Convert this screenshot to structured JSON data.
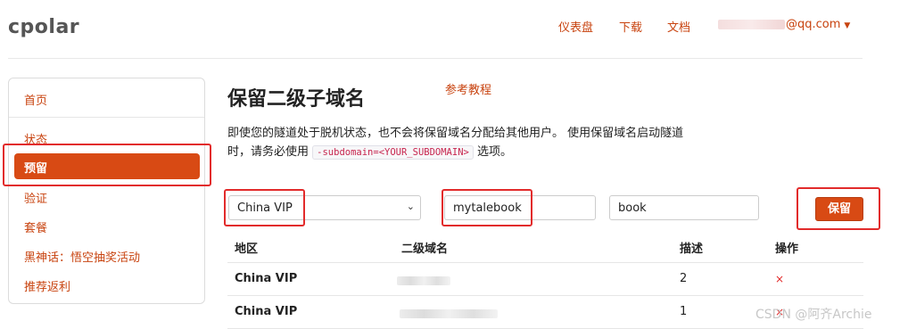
{
  "header": {
    "logo": "cpolar",
    "nav": [
      "仪表盘",
      "下载",
      "文档"
    ],
    "user_email_suffix": "@qq.com"
  },
  "sidebar": {
    "items": [
      "首页",
      "状态",
      "预留",
      "验证",
      "套餐",
      "黑神话：悟空抽奖活动",
      "推荐返利"
    ],
    "active": "预留"
  },
  "main": {
    "title": "保留二级子域名",
    "ref_link": "参考教程",
    "desc_part1": "即使您的隧道处于脱机状态，也不会将保留域名分配给其他用户。 使用保留域名启动隧道",
    "desc_part2_prefix": "时，请务必使用",
    "desc_code": "-subdomain=<YOUR_SUBDOMAIN>",
    "desc_part2_suffix": "选项。"
  },
  "form": {
    "region_selected": "China VIP",
    "subdomain_value": "mytalebook",
    "description_value": "book",
    "submit_label": "保留"
  },
  "table": {
    "headers": [
      "地区",
      "二级域名",
      "描述",
      "操作"
    ],
    "rows": [
      {
        "region": "China VIP",
        "description": "2",
        "action": "×"
      },
      {
        "region": "China VIP",
        "description": "1",
        "action": "×"
      }
    ]
  },
  "watermark": "CSDN @阿齐Archie",
  "colors": {
    "accent": "#d84a14",
    "link": "#c8430f",
    "highlight": "#e22b2b"
  }
}
